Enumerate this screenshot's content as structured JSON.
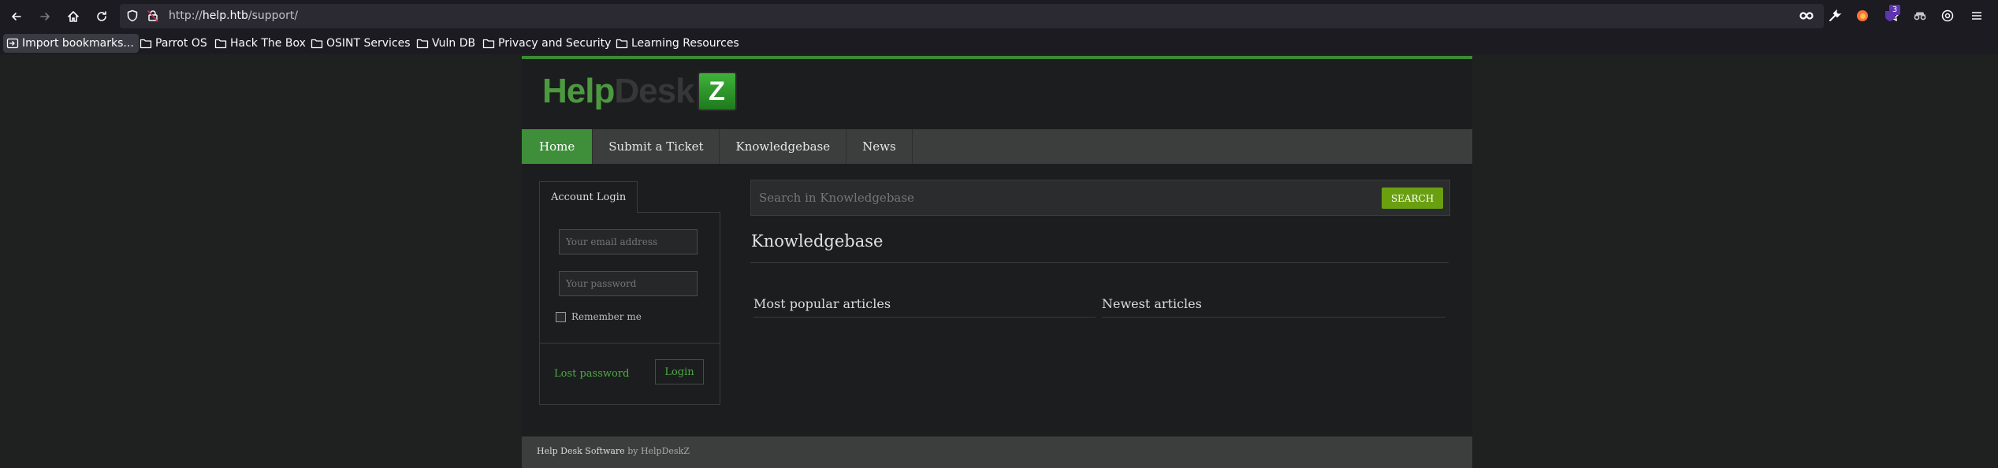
{
  "browser": {
    "url_scheme": "http://",
    "url_host": "help.htb",
    "url_path": "/support/",
    "bookmarks": [
      "Import bookmarks...",
      "Parrot OS",
      "Hack The Box",
      "OSINT Services",
      "Vuln DB",
      "Privacy and Security",
      "Learning Resources"
    ],
    "extension_badge": "3",
    "icons": [
      "back-icon",
      "forward-icon",
      "home-icon",
      "reload-icon",
      "shield-icon",
      "lock-icon",
      "star-icon",
      "infinity-icon",
      "wrench-icon",
      "firefox-icon",
      "extension-icon",
      "incognito-icon",
      "settings-icon",
      "menu-icon"
    ]
  },
  "site": {
    "logo_help": "Help",
    "logo_desk": "Desk",
    "logo_z": "Z",
    "accent": "#3e8e3a",
    "menu": [
      "Home",
      "Submit a Ticket",
      "Knowledgebase",
      "News"
    ],
    "login": {
      "tab_label": "Account Login",
      "email_placeholder": "Your email address",
      "password_placeholder": "Your password",
      "remember_label": "Remember me",
      "lost_password": "Lost password",
      "login_button": "Login"
    },
    "search": {
      "placeholder": "Search in Knowledgebase",
      "button": "SEARCH"
    },
    "kb": {
      "title": "Knowledgebase",
      "popular": "Most popular articles",
      "newest": "Newest articles"
    },
    "footer": {
      "text": "Help Desk Software",
      "by": "by HelpDeskZ"
    }
  }
}
